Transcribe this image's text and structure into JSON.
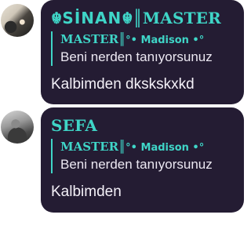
{
  "messages": [
    {
      "sender_prefix": "☬",
      "sender_name_styled": "SİNAN",
      "sender_sep": "☬║",
      "sender_suffix": "MASTER",
      "reply_author": "MASTER║",
      "reply_author_tail": "°• Madison •°",
      "reply_text": "Beni nerden tanıyorsunuz",
      "body": "Kalbimden dkskskxkd"
    },
    {
      "sender_name": "SEFA",
      "reply_author": "MASTER║",
      "reply_author_tail": "°• Madison •°",
      "reply_text": "Beni nerden tanıyorsunuz",
      "body": "Kalbimden"
    }
  ],
  "colors": {
    "bubble_bg": "#241c33",
    "accent": "#3fd5c7",
    "text": "#f4f1f8"
  }
}
